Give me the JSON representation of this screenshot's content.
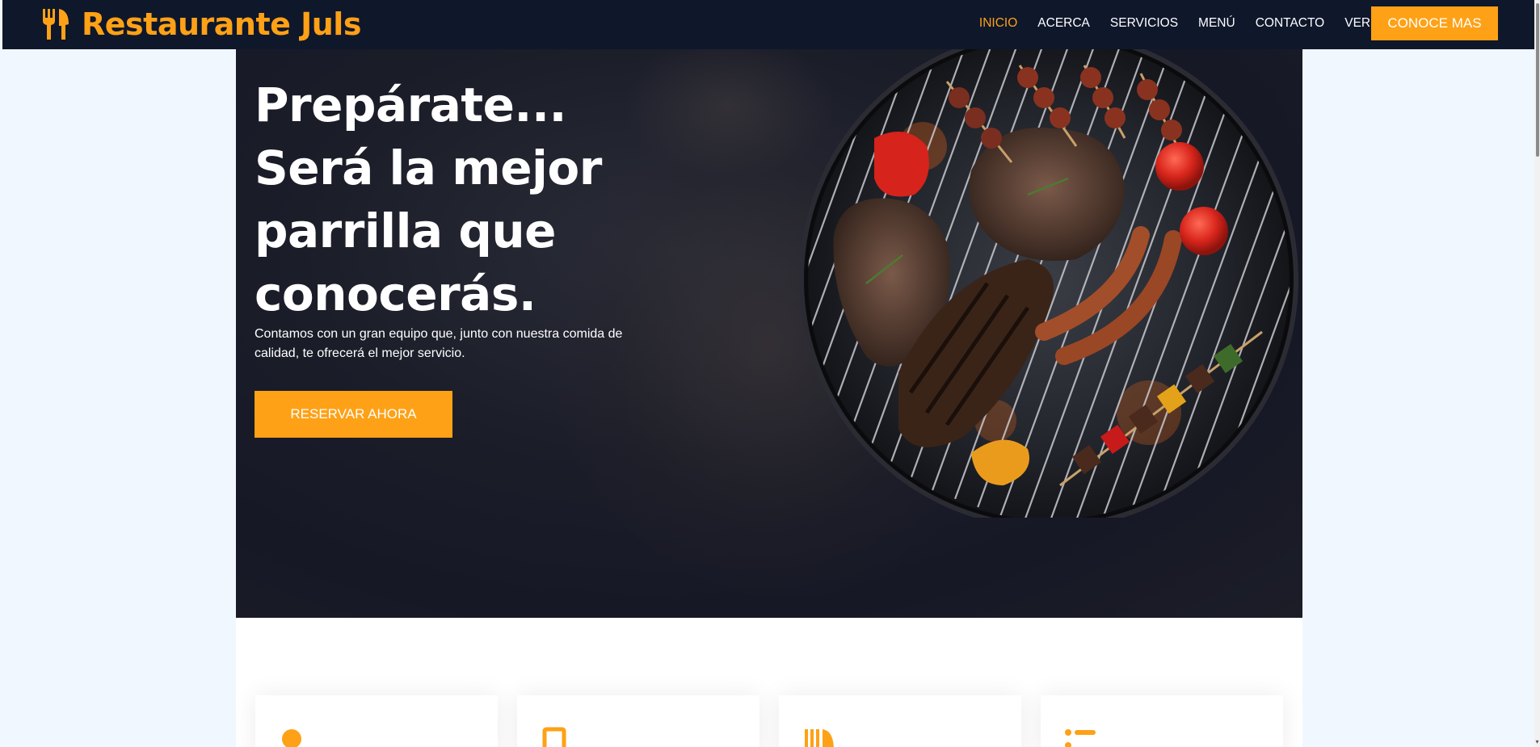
{
  "brand": {
    "title": "Restaurante Juls",
    "icon": "utensils-icon"
  },
  "nav": {
    "items": [
      {
        "label": "INICIO",
        "active": true
      },
      {
        "label": "ACERCA"
      },
      {
        "label": "SERVICIOS"
      },
      {
        "label": "MENÚ"
      },
      {
        "label": "CONTACTO"
      },
      {
        "label": "VER MAS",
        "dropdown": true
      }
    ],
    "cta": "CONOCE MAS"
  },
  "hero": {
    "title_lines": [
      "Prepárate...",
      "Será la mejor",
      "parrilla que",
      "conocerás."
    ],
    "subtitle": "Contamos con un gran equipo que, junto con nuestra comida de calidad, te ofrecerá el mejor servicio.",
    "button": "RESERVAR AHORA",
    "image": "grilled-meat-on-round-grill"
  },
  "services": {
    "card_icons": [
      "user-tie-icon",
      "cart-icon",
      "utensils-icon",
      "headset-icon"
    ]
  },
  "colors": {
    "accent": "#fea116",
    "navbar_bg": "#0f172b",
    "page_bg": "#f1f7ff",
    "text_light": "#ffffff"
  }
}
